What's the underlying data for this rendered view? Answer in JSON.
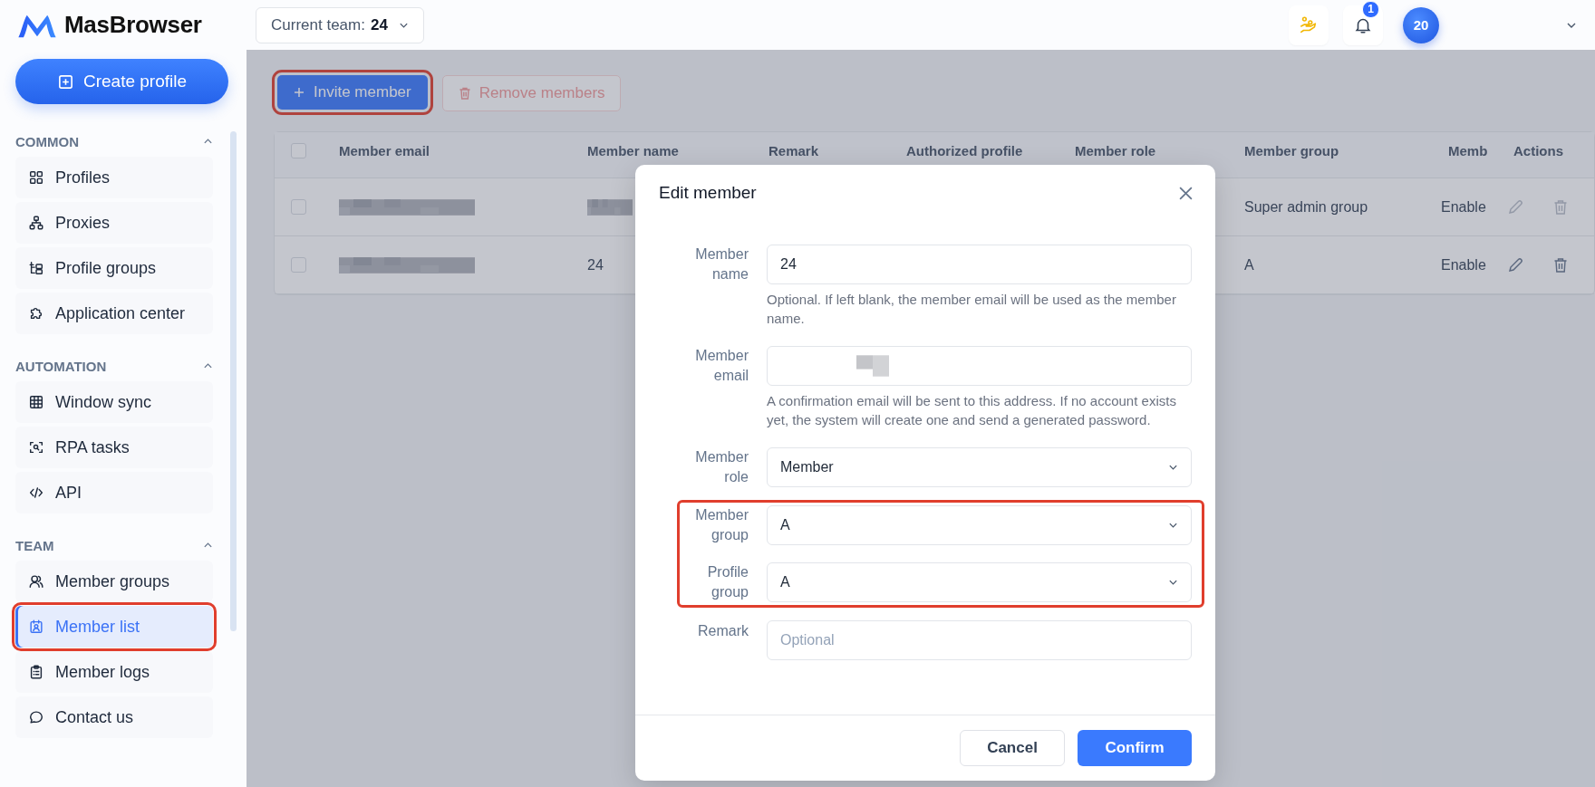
{
  "header": {
    "logo": "MasBrowser",
    "team_selector": {
      "label": "Current team:",
      "value": "24"
    },
    "notification_count": "1",
    "avatar": "20"
  },
  "sidebar": {
    "create_button": "Create profile",
    "sections": [
      {
        "title": "COMMON",
        "expanded": true,
        "items": [
          {
            "label": "Profiles",
            "selected": false,
            "highlighted": false
          },
          {
            "label": "Proxies",
            "selected": false,
            "highlighted": false
          },
          {
            "label": "Profile groups",
            "selected": false,
            "highlighted": false
          },
          {
            "label": "Application center",
            "selected": false,
            "highlighted": false
          }
        ]
      },
      {
        "title": "AUTOMATION",
        "expanded": true,
        "items": [
          {
            "label": "Window sync",
            "selected": false,
            "highlighted": false
          },
          {
            "label": "RPA tasks",
            "selected": false,
            "highlighted": false
          },
          {
            "label": "API",
            "selected": false,
            "highlighted": false
          }
        ]
      },
      {
        "title": "TEAM",
        "expanded": true,
        "items": [
          {
            "label": "Member groups",
            "selected": false,
            "highlighted": false
          },
          {
            "label": "Member list",
            "selected": true,
            "highlighted": true
          },
          {
            "label": "Member logs",
            "selected": false,
            "highlighted": false
          },
          {
            "label": "Contact us",
            "selected": false,
            "highlighted": false
          }
        ]
      }
    ]
  },
  "toolbar": {
    "invite_button": {
      "label": "Invite member",
      "highlighted": true
    },
    "remove_button": {
      "label": "Remove members",
      "disabled": true
    }
  },
  "table": {
    "select_all_checked": false,
    "columns": [
      "Member email",
      "Member name",
      "Remark",
      "Authorized profile",
      "Member role",
      "Member group",
      "Memb",
      "Actions"
    ],
    "rows": [
      {
        "checked": false,
        "email_redacted": true,
        "name": {
          "redacted": true
        },
        "group": "Super admin group",
        "status": "Enable",
        "actions_disabled": true
      },
      {
        "checked": false,
        "email_redacted": true,
        "name": {
          "redacted": false,
          "text": "24"
        },
        "group": "A",
        "status": "Enable",
        "actions_disabled": false
      }
    ]
  },
  "modal": {
    "title": "Edit member",
    "fields": [
      {
        "label": "Member name",
        "kind": "text",
        "value": "24",
        "help": "Optional. If left blank, the member email will be used as the member name.",
        "highlighted": false
      },
      {
        "label": "Member email",
        "kind": "text",
        "redacted": true,
        "help": "A confirmation email will be sent to this address. If no account exists yet, the system will create one and send a generated password.",
        "highlighted": false
      },
      {
        "label": "Member role",
        "kind": "select",
        "value": "Member",
        "highlighted": false
      },
      {
        "label": "Member group",
        "kind": "select",
        "value": "A",
        "highlighted": true
      },
      {
        "label": "Profile group",
        "kind": "select",
        "value": "A",
        "highlighted": true
      },
      {
        "label": "Remark",
        "kind": "text",
        "placeholder": "Optional",
        "highlighted": false
      }
    ],
    "cancel_button": "Cancel",
    "confirm_button": "Confirm"
  }
}
